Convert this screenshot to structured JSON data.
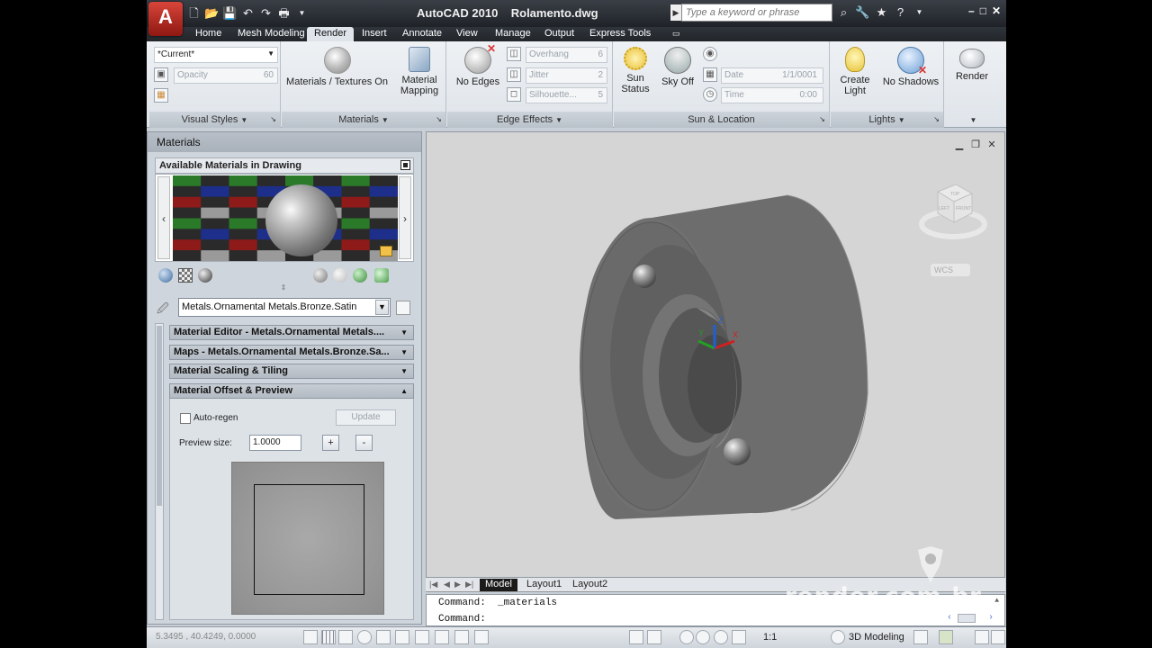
{
  "titlebar": {
    "app_logo": "A",
    "title": "AutoCAD 2010    Rolamento.dwg",
    "search_placeholder": "Type a keyword or phrase"
  },
  "tabs": [
    {
      "label": "Home",
      "active": false
    },
    {
      "label": "Mesh Modeling",
      "active": false
    },
    {
      "label": "Render",
      "active": true
    },
    {
      "label": "Insert",
      "active": false
    },
    {
      "label": "Annotate",
      "active": false
    },
    {
      "label": "View",
      "active": false
    },
    {
      "label": "Manage",
      "active": false
    },
    {
      "label": "Output",
      "active": false
    },
    {
      "label": "Express Tools",
      "active": false
    }
  ],
  "ribbon": {
    "visual_styles": {
      "current": "*Current*",
      "opacity_label": "Opacity",
      "opacity_value": "60",
      "panel_title": "Visual Styles"
    },
    "materials": {
      "materials_textures": "Materials / Textures On",
      "material_mapping": "Material Mapping",
      "panel_title": "Materials"
    },
    "edge_effects": {
      "no_edges": "No Edges",
      "overhang_label": "Overhang",
      "overhang_value": "6",
      "jitter_label": "Jitter",
      "jitter_value": "2",
      "silhouette_label": "Silhouette...",
      "silhouette_value": "5",
      "panel_title": "Edge Effects"
    },
    "sun_location": {
      "sun_status": "Sun Status",
      "sky_off": "Sky Off",
      "date_label": "Date",
      "date_value": "1/1/0001",
      "time_label": "Time",
      "time_value": "0:00",
      "panel_title": "Sun & Location"
    },
    "lights": {
      "create_light": "Create Light",
      "no_shadows": "No Shadows",
      "panel_title": "Lights"
    },
    "render": {
      "label": "Render"
    }
  },
  "palette": {
    "title": "Materials",
    "available_header": "Available Materials in Drawing",
    "selected_material": "Metals.Ornamental Metals.Bronze.Satin",
    "sections": [
      {
        "label": "Material Editor - Metals.Ornamental Metals....",
        "expanded": false
      },
      {
        "label": "Maps - Metals.Ornamental Metals.Bronze.Sa...",
        "expanded": false
      },
      {
        "label": "Material Scaling & Tiling",
        "expanded": false
      },
      {
        "label": "Material Offset & Preview",
        "expanded": true
      }
    ],
    "auto_regen_label": "Auto-regen",
    "update_label": "Update",
    "preview_size_label": "Preview size:",
    "preview_size_value": "1.0000",
    "plus": "+",
    "minus": "-"
  },
  "viewport": {
    "viewcube_labels": {
      "top": "TOP",
      "left": "LEFT",
      "front": "FRONT"
    },
    "wcs_label": "WCS",
    "ucs": {
      "x": "X",
      "y": "Y",
      "z": "Z"
    }
  },
  "layout_tabs": [
    {
      "label": "Model",
      "active": true
    },
    {
      "label": "Layout1",
      "active": false
    },
    {
      "label": "Layout2",
      "active": false
    }
  ],
  "command": {
    "line1": "Command:  _materials",
    "line2": "Command:"
  },
  "statusbar": {
    "coords": "5.3495 , 40.4249, 0.0000",
    "scale": "1:1",
    "workspace": "3D Modeling"
  },
  "watermark": "render.com.br",
  "colors": {
    "accent": "#d8453a",
    "titlebar": "#2a2e34",
    "viewport_bg": "#d5d5d5",
    "bearing_gray": "#7a7a7a"
  }
}
